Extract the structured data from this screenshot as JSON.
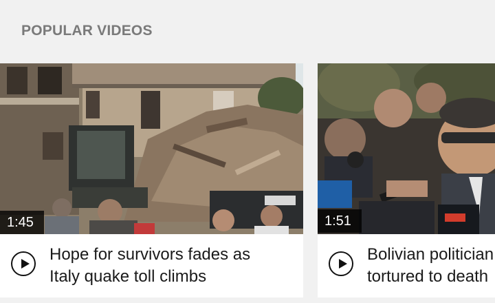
{
  "section": {
    "title": "POPULAR VIDEOS"
  },
  "videos": [
    {
      "duration": "1:45",
      "headline": "Hope for survivors fades as\nItaly quake toll climbs",
      "thumbnail": "earthquake rubble with excavator"
    },
    {
      "duration": "1:51",
      "headline": "Bolivian politician\ntortured to death",
      "thumbnail": "politician speaking to reporters with microphones"
    }
  ],
  "icons": {
    "play": "play-circle-icon"
  }
}
